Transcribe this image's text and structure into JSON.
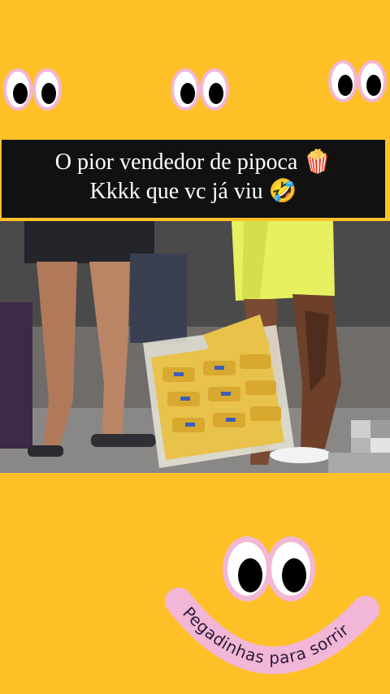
{
  "caption": {
    "line1": "O pior vendedor  de pipoca 🍿",
    "line2": "Kkkk que vc já viu 🤣"
  },
  "brand": {
    "text": "Pegadinhas para sorrir"
  },
  "colors": {
    "background": "#FDC127",
    "caption_bg": "#111111",
    "eye_ring": "#F2B7D6",
    "brand_text": "#2B1B3D"
  },
  "icons": [
    "googly-eyes-icon",
    "popcorn-emoji",
    "rofl-emoji"
  ]
}
